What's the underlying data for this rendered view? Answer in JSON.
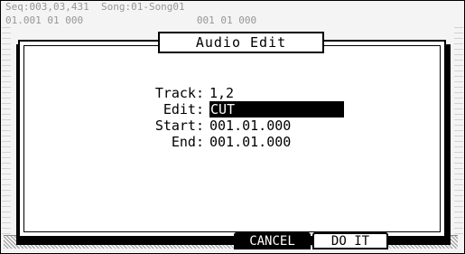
{
  "background": {
    "line1": "Seq:003,03,431  Song:01-Song01",
    "line2": "01.001 01 000                   001 01 000"
  },
  "dialog": {
    "title": "Audio Edit",
    "fields": [
      {
        "label": "Track:",
        "value": "1,2"
      },
      {
        "label": "Edit:",
        "value": "CUT",
        "selected": true
      },
      {
        "label": "Start:",
        "value": "001.01.000"
      },
      {
        "label": "End:",
        "value": "001.01.000"
      }
    ]
  },
  "softkeys": {
    "cancel": "CANCEL",
    "do_it": "DO IT"
  }
}
